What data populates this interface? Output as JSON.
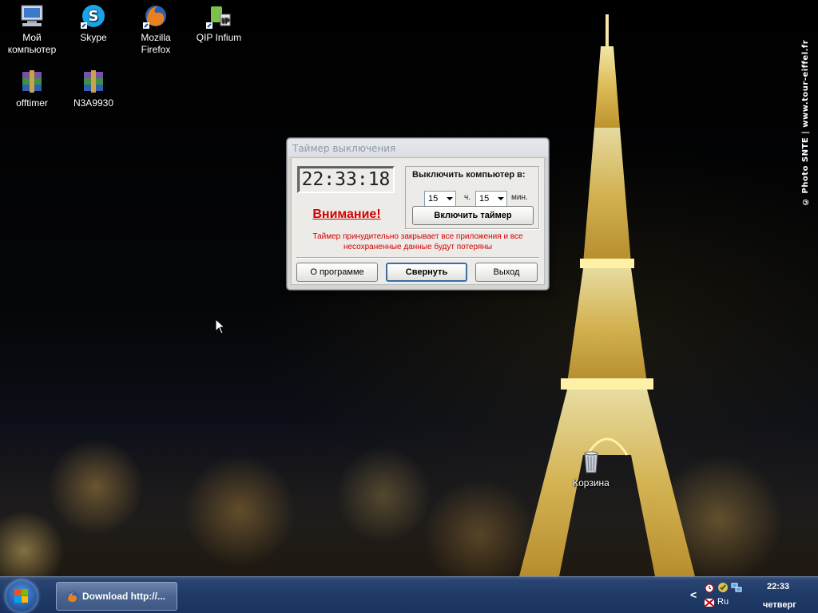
{
  "desktop": {
    "icons": [
      {
        "label": "Мой\nкомпьютер",
        "icon": "computer-icon"
      },
      {
        "label": "Skype",
        "icon": "skype-icon"
      },
      {
        "label": "Mozilla\nFirefox",
        "icon": "firefox-icon"
      },
      {
        "label": "QIP Infium",
        "icon": "qip-icon"
      },
      {
        "label": "offtimer",
        "icon": "winrar-archive-icon"
      },
      {
        "label": "N3A9930",
        "icon": "winrar-archive-icon"
      },
      {
        "label": "Корзина",
        "icon": "recycle-bin-icon"
      }
    ],
    "watermark": "© Photo SNTE | www.tour-eiffel.fr"
  },
  "dialog": {
    "title": "Таймер выключения",
    "clock": "22:33:18",
    "warning": "Внимание!",
    "group_title": "Выключить компьютер в:",
    "hours_value": "15",
    "hours_unit": "ч.",
    "minutes_value": "15",
    "minutes_unit": "мин.",
    "enable_timer_label": "Включить таймер",
    "notice_line1": "Таймер принудительно закрывает все приложения и все",
    "notice_line2": "несохраненные данные будут потеряны",
    "about_label": "О программе",
    "minimize_label": "Свернуть",
    "exit_label": "Выход"
  },
  "taskbar": {
    "task_button_label": "Download http://...",
    "tray": {
      "chevron": "<",
      "language": "Ru",
      "time": "22:33",
      "day": "четверг"
    }
  },
  "colors": {
    "warning_red": "#d40000",
    "taskbar_blue": "#1f3a66"
  }
}
